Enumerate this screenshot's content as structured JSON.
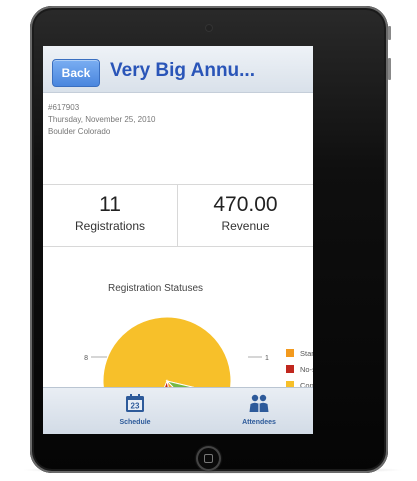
{
  "header": {
    "back_label": "Back",
    "title": "Very Big Annu..."
  },
  "event": {
    "id": "#617903",
    "date": "Thursday, November 25, 2010",
    "location": "Boulder Colorado"
  },
  "stats": {
    "registrations_value": "11",
    "registrations_label": "Registrations",
    "revenue_value": "470.00",
    "revenue_label": "Revenue"
  },
  "chart_title": "Registration Statuses",
  "chart_data": {
    "type": "pie",
    "title": "Registration Statuses",
    "slices": [
      {
        "name": "Confirmed",
        "value": 8,
        "color": "#f7c02a"
      },
      {
        "name": "No-show",
        "value": 1,
        "color": "#c0271e"
      },
      {
        "name": "Standby",
        "value": 1,
        "color": "#f39a1e"
      },
      {
        "name": "",
        "value": 1,
        "color": "#74b845"
      }
    ],
    "data_labels": [
      "8",
      "1"
    ],
    "legend": [
      "Standby",
      "No-show",
      "Confirmed"
    ],
    "legend_position": "right"
  },
  "tabs": {
    "schedule_label": "Schedule",
    "schedule_icon_text": "23",
    "attendees_label": "Attendees"
  },
  "icons": {
    "back": "back-button",
    "schedule": "calendar-icon",
    "attendees": "people-icon"
  },
  "colors": {
    "title": "#2a55b8",
    "back_button": "#4a86de",
    "tab_label": "#2d5a9a"
  }
}
